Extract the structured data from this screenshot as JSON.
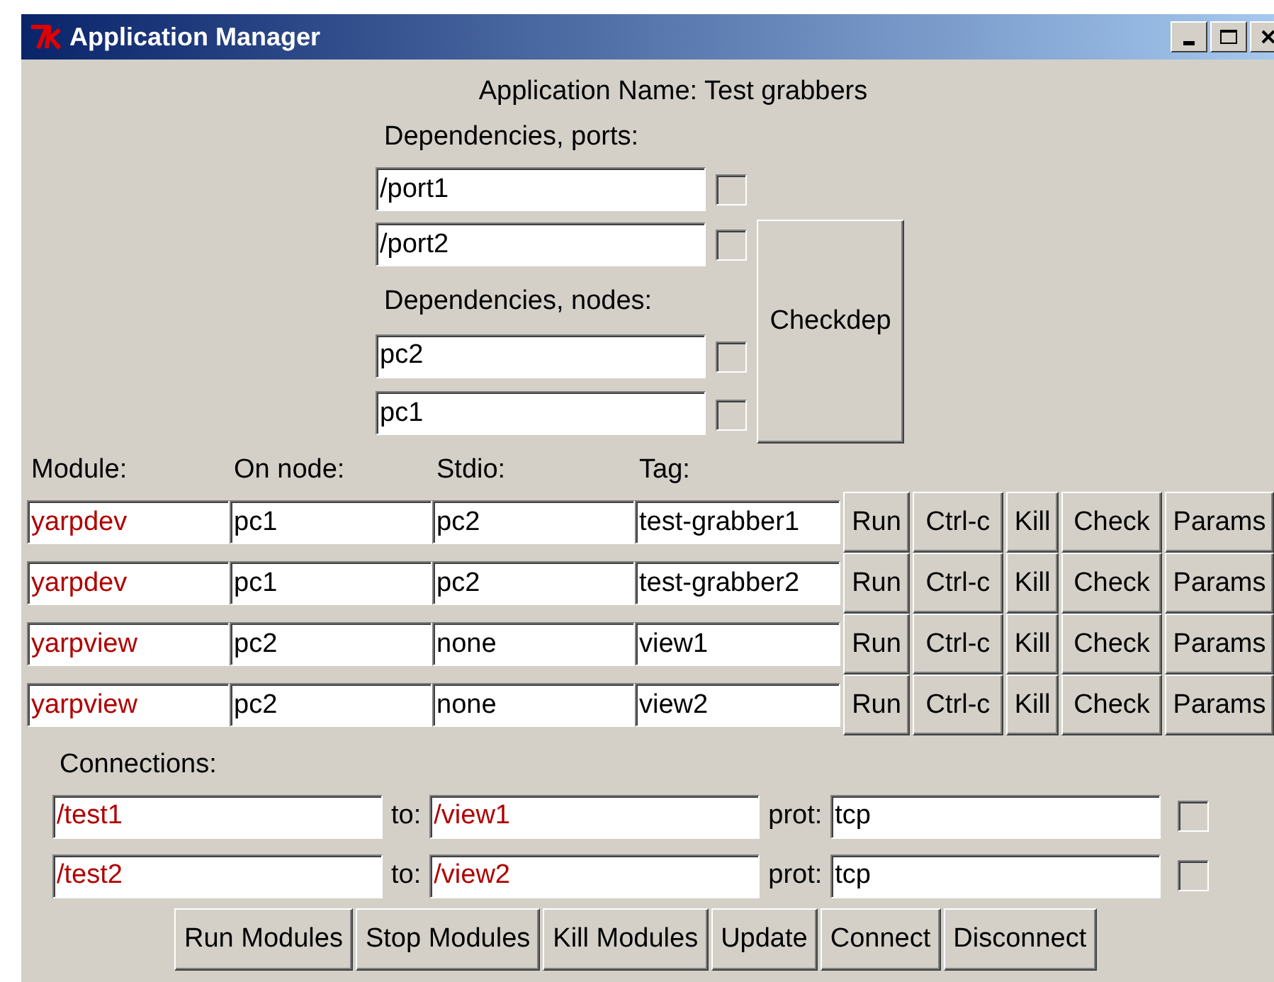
{
  "window": {
    "title": "Application Manager"
  },
  "application_name": "Application Name: Test grabbers",
  "dependencies": {
    "ports_label": "Dependencies, ports:",
    "ports": [
      {
        "value": "/port1",
        "checked": false
      },
      {
        "value": "/port2",
        "checked": false
      }
    ],
    "nodes_label": "Dependencies, nodes:",
    "nodes": [
      {
        "value": "pc2",
        "checked": false
      },
      {
        "value": "pc1",
        "checked": false
      }
    ],
    "check_button": "Checkdep"
  },
  "modules": {
    "columns": [
      "Module:",
      "On node:",
      "Stdio:",
      "Tag:"
    ],
    "rows": [
      {
        "module": "yarpdev",
        "node": "pc1",
        "stdio": "pc2",
        "tag": "test-grabber1",
        "actions": [
          "Run",
          "Ctrl-c",
          "Kill",
          "Check",
          "Params"
        ]
      },
      {
        "module": "yarpdev",
        "node": "pc1",
        "stdio": "pc2",
        "tag": "test-grabber2",
        "actions": [
          "Run",
          "Ctrl-c",
          "Kill",
          "Check",
          "Params"
        ]
      },
      {
        "module": "yarpview",
        "node": "pc2",
        "stdio": "none",
        "tag": "view1",
        "actions": [
          "Run",
          "Ctrl-c",
          "Kill",
          "Check",
          "Params"
        ]
      },
      {
        "module": "yarpview",
        "node": "pc2",
        "stdio": "none",
        "tag": "view2",
        "actions": [
          "Run",
          "Ctrl-c",
          "Kill",
          "Check",
          "Params"
        ]
      }
    ]
  },
  "connections": {
    "label": "Connections:",
    "rows": [
      {
        "from": "/test1",
        "to_label": "to:",
        "to": "/view1",
        "prot_label": "prot:",
        "protocol": "tcp",
        "checked": false
      },
      {
        "from": "/test2",
        "to_label": "to:",
        "to": "/view2",
        "prot_label": "prot:",
        "protocol": "tcp",
        "checked": false
      }
    ]
  },
  "buttons": [
    "Run Modules",
    "Stop Modules",
    "Kill Modules",
    "Update",
    "Connect",
    "Disconnect"
  ]
}
